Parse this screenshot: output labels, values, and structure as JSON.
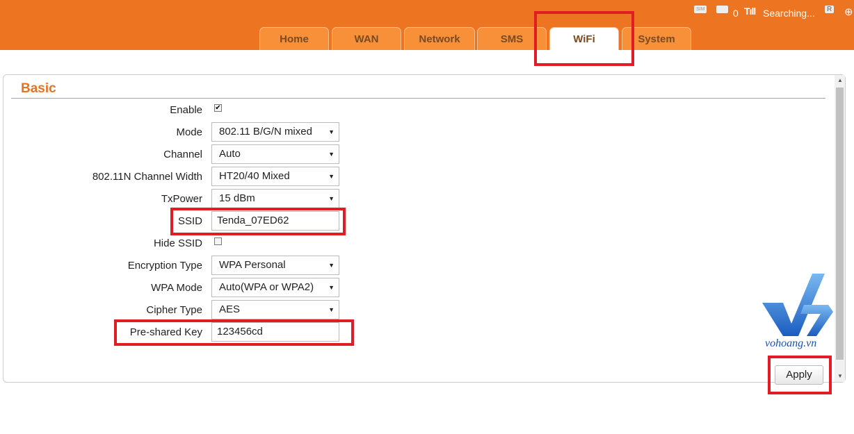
{
  "status": {
    "sms_count": "0",
    "network": "Searching...",
    "sim_label": "SIM",
    "roaming": "R"
  },
  "tabs": [
    {
      "label": "Home"
    },
    {
      "label": "WAN"
    },
    {
      "label": "Network"
    },
    {
      "label": "SMS"
    },
    {
      "label": "WiFi"
    },
    {
      "label": "System"
    }
  ],
  "section_title": "Basic",
  "form": {
    "enable": {
      "label": "Enable",
      "checked": true
    },
    "mode": {
      "label": "Mode",
      "value": "802.11 B/G/N mixed"
    },
    "channel": {
      "label": "Channel",
      "value": "Auto"
    },
    "width": {
      "label": "802.11N Channel Width",
      "value": "HT20/40 Mixed"
    },
    "txpower": {
      "label": "TxPower",
      "value": "15 dBm"
    },
    "ssid": {
      "label": "SSID",
      "value": "Tenda_07ED62"
    },
    "hide": {
      "label": "Hide SSID",
      "checked": false
    },
    "enc": {
      "label": "Encryption Type",
      "value": "WPA Personal"
    },
    "wpa": {
      "label": "WPA Mode",
      "value": "Auto(WPA or WPA2)"
    },
    "cipher": {
      "label": "Cipher Type",
      "value": "AES"
    },
    "psk": {
      "label": "Pre-shared Key",
      "value": "123456cd"
    }
  },
  "apply_label": "Apply",
  "watermark": "vohoang.vn",
  "colors": {
    "header": "#ed7420",
    "highlight": "#e01c24"
  }
}
